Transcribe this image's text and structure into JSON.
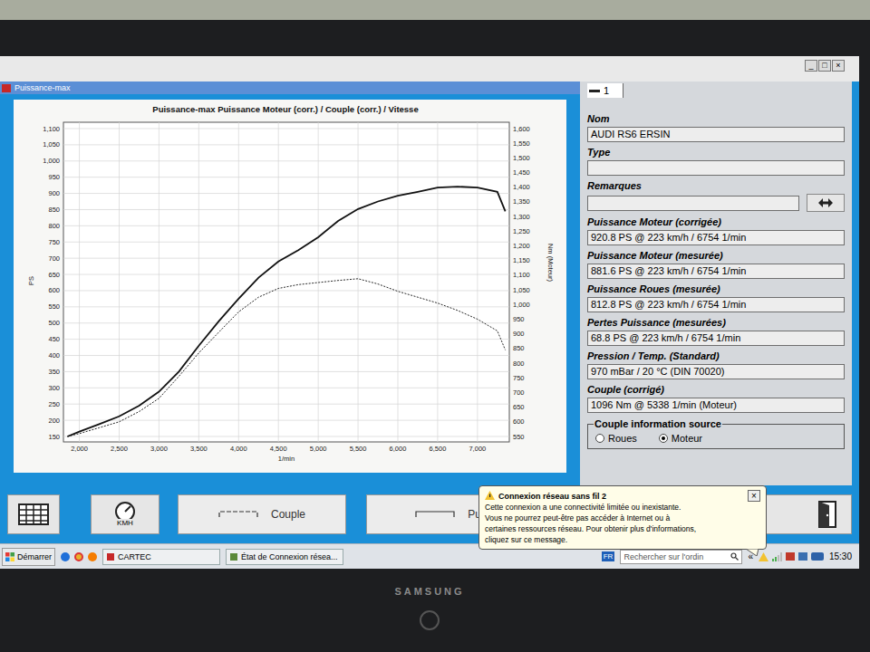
{
  "monitor": {
    "brand": "SAMSUNG"
  },
  "window": {
    "title": "Puissance-max",
    "controls": [
      "_",
      "□",
      "×"
    ]
  },
  "chart": {
    "title": "Puissance-max Puissance Moteur (corr.) / Couple (corr.) / Vitesse",
    "y_left": {
      "label": "PS",
      "ticks": [
        "150",
        "200",
        "250",
        "300",
        "350",
        "400",
        "450",
        "500",
        "550",
        "600",
        "650",
        "700",
        "750",
        "800",
        "850",
        "900",
        "950",
        "1,000",
        "1,050",
        "1,100"
      ]
    },
    "y_right": {
      "label": "Nm (Moteur)",
      "ticks": [
        "550",
        "600",
        "650",
        "700",
        "750",
        "800",
        "850",
        "900",
        "950",
        "1,000",
        "1,050",
        "1,100",
        "1,150",
        "1,200",
        "1,250",
        "1,300",
        "1,350",
        "1,400",
        "1,450",
        "1,500",
        "1,550",
        "1,600"
      ]
    },
    "x": {
      "label": "1/min",
      "ticks": [
        "2,000",
        "2,500",
        "3,000",
        "3,500",
        "4,000",
        "4,500",
        "5,000",
        "5,500",
        "6,000",
        "6,500",
        "7,000"
      ]
    },
    "rpm": [
      1850,
      2000,
      2250,
      2500,
      2750,
      3000,
      3250,
      3500,
      3750,
      4000,
      4250,
      4500,
      4750,
      5000,
      5250,
      5500,
      5750,
      6000,
      6250,
      6500,
      6750,
      7000,
      7250,
      7350
    ],
    "series": [
      {
        "kind": "solid",
        "axis": "left",
        "values": [
          150,
          165,
          188,
          212,
          245,
          288,
          350,
          430,
          505,
          575,
          640,
          690,
          725,
          765,
          815,
          852,
          875,
          893,
          905,
          918,
          921,
          918,
          905,
          845
        ]
      },
      {
        "kind": "dashed",
        "axis": "right",
        "values": [
          550,
          560,
          580,
          600,
          635,
          680,
          755,
          835,
          905,
          975,
          1025,
          1055,
          1068,
          1075,
          1082,
          1088,
          1070,
          1045,
          1025,
          1005,
          980,
          950,
          910,
          845
        ]
      }
    ]
  },
  "panel": {
    "tab": {
      "label": "1",
      "selected": true
    },
    "fields": [
      {
        "label": "Nom",
        "value": "AUDI RS6 ERSIN",
        "kind": "text"
      },
      {
        "label": "Type",
        "value": "",
        "kind": "text"
      },
      {
        "label": "Remarques",
        "value": "",
        "kind": "button"
      },
      {
        "label": "Puissance Moteur (corrigée)",
        "value": "920.8 PS @ 223 km/h / 6754 1/min",
        "kind": "text"
      },
      {
        "label": "Puissance Moteur (mesurée)",
        "value": "881.6 PS @ 223 km/h / 6754 1/min",
        "kind": "text"
      },
      {
        "label": "Puissance Roues (mesurée)",
        "value": "812.8 PS @ 223 km/h / 6754 1/min",
        "kind": "text"
      },
      {
        "label": "Pertes Puissance (mesurées)",
        "value": "68.8 PS @ 223 km/h / 6754 1/min",
        "kind": "text"
      },
      {
        "label": "Pression / Temp. (Standard)",
        "value": "970 mBar / 20 °C (DIN 70020)",
        "kind": "text"
      },
      {
        "label": "Couple (corrigé)",
        "value": "1096 Nm @ 5338 1/min (Moteur)",
        "kind": "text"
      }
    ],
    "source": {
      "label": "Couple information source",
      "options": [
        {
          "label": "Roues",
          "selected": false
        },
        {
          "label": "Moteur",
          "selected": true
        }
      ]
    }
  },
  "toolbar": {
    "buttons": [
      {
        "kind": "table"
      },
      {
        "kind": "gauge",
        "label": "KMH"
      },
      {
        "kind": "dashed",
        "label": "Couple"
      },
      {
        "kind": "solid",
        "label": "Puiss"
      },
      {
        "kind": "exit"
      }
    ]
  },
  "notification": {
    "title": "Connexion réseau sans fil 2",
    "lines": [
      "Cette connexion a une connectivité limitée ou inexistante.",
      "Vous ne pourrez peut-être pas accéder à Internet ou à",
      "certaines ressources réseau. Pour obtenir plus d'informations,",
      "cliquez sur ce message."
    ],
    "close": "×"
  },
  "taskbar": {
    "start": "Démarrer",
    "items": [
      {
        "label": "CARTEC"
      },
      {
        "label": "État de Connexion résea..."
      }
    ],
    "language": "FR",
    "search": {
      "placeholder": "Rechercher sur l'ordin"
    },
    "expand": "«",
    "time": "15:30"
  }
}
